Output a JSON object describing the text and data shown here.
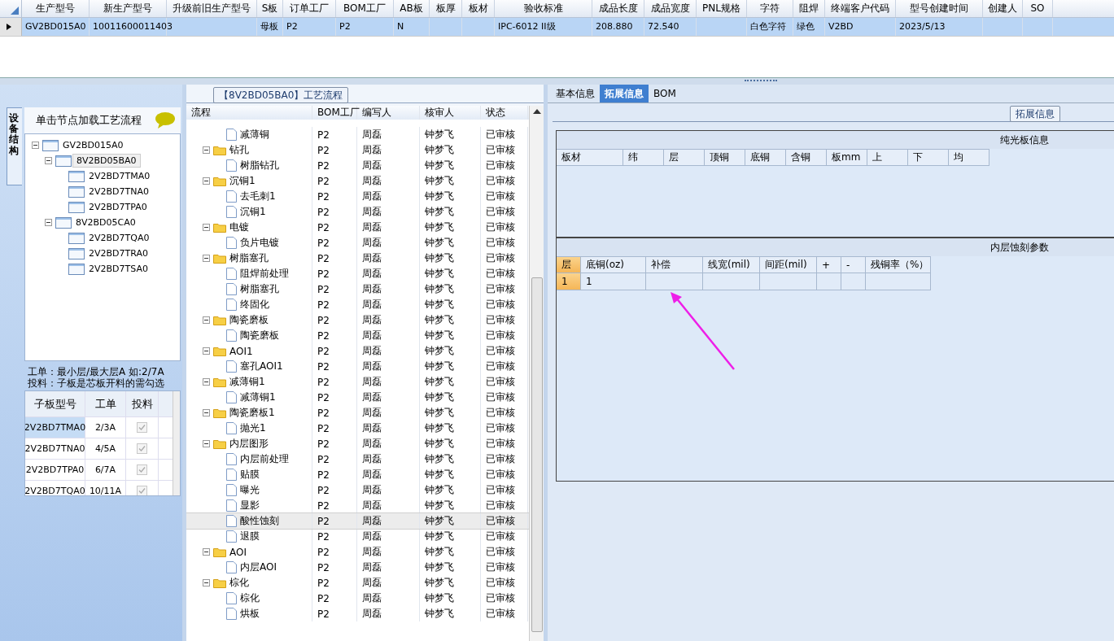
{
  "product_grid": {
    "columns": [
      {
        "label": "生产型号",
        "value": "GV2BD015A0"
      },
      {
        "label": "新生产型号",
        "value": "10011600011403"
      },
      {
        "label": "升级前旧生产型号"
      },
      {
        "label": "S板",
        "value": "母板"
      },
      {
        "label": "订单工厂",
        "value": "P2"
      },
      {
        "label": "BOM工厂",
        "value": "P2"
      },
      {
        "label": "AB板",
        "value": "N"
      },
      {
        "label": "板厚"
      },
      {
        "label": "板材"
      },
      {
        "label": "验收标准",
        "value": "IPC-6012 II级"
      },
      {
        "label": "成品长度",
        "value": "208.880"
      },
      {
        "label": "成品宽度",
        "value": "72.540"
      },
      {
        "label": "PNL规格"
      },
      {
        "label": "字符",
        "value": "白色字符"
      },
      {
        "label": "阻焊",
        "value": "绿色"
      },
      {
        "label": "终端客户代码",
        "value": "V2BD"
      },
      {
        "label": "型号创建时间",
        "value": "2023/5/13"
      },
      {
        "label": "创建人"
      },
      {
        "label": "SO"
      }
    ],
    "row_selected": true
  },
  "structure_panel": {
    "side_tab": "设备结构",
    "hint": "单击节点加载工艺流程",
    "tree": [
      {
        "label": "GV2BD015A0",
        "expanded": true,
        "selected": false,
        "children": [
          {
            "label": "8V2BD05BA0",
            "expanded": true,
            "selected": true,
            "children": [
              {
                "label": "2V2BD7TMA0",
                "selected": false
              },
              {
                "label": "2V2BD7TNA0",
                "selected": false
              },
              {
                "label": "2V2BD7TPA0",
                "selected": false
              }
            ]
          },
          {
            "label": "8V2BD05CA0",
            "expanded": true,
            "selected": false,
            "children": [
              {
                "label": "2V2BD7TQA0",
                "selected": false
              },
              {
                "label": "2V2BD7TRA0",
                "selected": false
              },
              {
                "label": "2V2BD7TSA0",
                "selected": false
              }
            ]
          }
        ]
      }
    ],
    "notes": [
      "工单：最小层/最大层A 如:2/7A",
      "投料：子板是芯板开料的需勾选"
    ],
    "board_table": {
      "columns": [
        "子板型号",
        "工单",
        "投料"
      ],
      "rows": [
        {
          "model": "2V2BD7TMA0",
          "order": "2/3A",
          "feed": true,
          "selected": true
        },
        {
          "model": "2V2BD7TNA0",
          "order": "4/5A",
          "feed": true,
          "selected": false
        },
        {
          "model": "2V2BD7TPA0",
          "order": "6/7A",
          "feed": true,
          "selected": false
        },
        {
          "model": "2V2BD7TQA0",
          "order": "10/11A",
          "feed": true,
          "selected": false
        }
      ]
    }
  },
  "process": {
    "title": "【8V2BD05BA0】工艺流程",
    "columns": [
      "流程",
      "BOM工厂",
      "编写人",
      "核审人",
      "状态"
    ],
    "rows": [
      {
        "children": [
          {
            "name": "减薄铜",
            "factory": "P2",
            "author": "周磊",
            "reviewer": "钟梦飞",
            "status": "已审核",
            "selected": false
          }
        ]
      },
      {
        "name": "钻孔",
        "factory": "P2",
        "author": "周磊",
        "reviewer": "钟梦飞",
        "status": "已审核",
        "selected": false,
        "expanded": true,
        "children": [
          {
            "name": "树脂钻孔",
            "factory": "P2",
            "author": "周磊",
            "reviewer": "钟梦飞",
            "status": "已审核",
            "selected": false
          }
        ]
      },
      {
        "name": "沉铜1",
        "factory": "P2",
        "author": "周磊",
        "reviewer": "钟梦飞",
        "status": "已审核",
        "selected": false,
        "expanded": true,
        "children": [
          {
            "name": "去毛刺1",
            "factory": "P2",
            "author": "周磊",
            "reviewer": "钟梦飞",
            "status": "已审核",
            "selected": false
          },
          {
            "name": "沉铜1",
            "factory": "P2",
            "author": "周磊",
            "reviewer": "钟梦飞",
            "status": "已审核",
            "selected": false
          }
        ]
      },
      {
        "name": "电镀",
        "factory": "P2",
        "author": "周磊",
        "reviewer": "钟梦飞",
        "status": "已审核",
        "selected": false,
        "expanded": true,
        "children": [
          {
            "name": "负片电镀",
            "factory": "P2",
            "author": "周磊",
            "reviewer": "钟梦飞",
            "status": "已审核",
            "selected": false
          }
        ]
      },
      {
        "name": "树脂塞孔",
        "factory": "P2",
        "author": "周磊",
        "reviewer": "钟梦飞",
        "status": "已审核",
        "selected": false,
        "expanded": true,
        "children": [
          {
            "name": "阻焊前处理",
            "factory": "P2",
            "author": "周磊",
            "reviewer": "钟梦飞",
            "status": "已审核",
            "selected": false
          },
          {
            "name": "树脂塞孔",
            "factory": "P2",
            "author": "周磊",
            "reviewer": "钟梦飞",
            "status": "已审核",
            "selected": false
          },
          {
            "name": "终固化",
            "factory": "P2",
            "author": "周磊",
            "reviewer": "钟梦飞",
            "status": "已审核",
            "selected": false
          }
        ]
      },
      {
        "name": "陶瓷磨板",
        "factory": "P2",
        "author": "周磊",
        "reviewer": "钟梦飞",
        "status": "已审核",
        "selected": false,
        "expanded": true,
        "children": [
          {
            "name": "陶瓷磨板",
            "factory": "P2",
            "author": "周磊",
            "reviewer": "钟梦飞",
            "status": "已审核",
            "selected": false
          }
        ]
      },
      {
        "name": "AOI1",
        "factory": "P2",
        "author": "周磊",
        "reviewer": "钟梦飞",
        "status": "已审核",
        "selected": false,
        "expanded": true,
        "children": [
          {
            "name": "塞孔AOI1",
            "factory": "P2",
            "author": "周磊",
            "reviewer": "钟梦飞",
            "status": "已审核",
            "selected": false
          }
        ]
      },
      {
        "name": "减薄铜1",
        "factory": "P2",
        "author": "周磊",
        "reviewer": "钟梦飞",
        "status": "已审核",
        "selected": false,
        "expanded": true,
        "children": [
          {
            "name": "减薄铜1",
            "factory": "P2",
            "author": "周磊",
            "reviewer": "钟梦飞",
            "status": "已审核",
            "selected": false
          }
        ]
      },
      {
        "name": "陶瓷磨板1",
        "factory": "P2",
        "author": "周磊",
        "reviewer": "钟梦飞",
        "status": "已审核",
        "selected": false,
        "expanded": true,
        "children": [
          {
            "name": "抛光1",
            "factory": "P2",
            "author": "周磊",
            "reviewer": "钟梦飞",
            "status": "已审核",
            "selected": false
          }
        ]
      },
      {
        "name": "内层图形",
        "factory": "P2",
        "author": "周磊",
        "reviewer": "钟梦飞",
        "status": "已审核",
        "selected": false,
        "expanded": true,
        "children": [
          {
            "name": "内层前处理",
            "factory": "P2",
            "author": "周磊",
            "reviewer": "钟梦飞",
            "status": "已审核",
            "selected": false
          },
          {
            "name": "贴膜",
            "factory": "P2",
            "author": "周磊",
            "reviewer": "钟梦飞",
            "status": "已审核",
            "selected": false
          },
          {
            "name": "曝光",
            "factory": "P2",
            "author": "周磊",
            "reviewer": "钟梦飞",
            "status": "已审核",
            "selected": false
          },
          {
            "name": "显影",
            "factory": "P2",
            "author": "周磊",
            "reviewer": "钟梦飞",
            "status": "已审核",
            "selected": false
          },
          {
            "name": "酸性蚀刻",
            "factory": "P2",
            "author": "周磊",
            "reviewer": "钟梦飞",
            "status": "已审核",
            "selected": true
          },
          {
            "name": "退膜",
            "factory": "P2",
            "author": "周磊",
            "reviewer": "钟梦飞",
            "status": "已审核",
            "selected": false
          }
        ]
      },
      {
        "name": "AOI",
        "factory": "P2",
        "author": "周磊",
        "reviewer": "钟梦飞",
        "status": "已审核",
        "selected": false,
        "expanded": true,
        "children": [
          {
            "name": "内层AOI",
            "factory": "P2",
            "author": "周磊",
            "reviewer": "钟梦飞",
            "status": "已审核",
            "selected": false
          }
        ]
      },
      {
        "name": "棕化",
        "factory": "P2",
        "author": "周磊",
        "reviewer": "钟梦飞",
        "status": "已审核",
        "selected": false,
        "expanded": true,
        "children": [
          {
            "name": "棕化",
            "factory": "P2",
            "author": "周磊",
            "reviewer": "钟梦飞",
            "status": "已审核",
            "selected": false
          },
          {
            "name": "烘板",
            "factory": "P2",
            "author": "周磊",
            "reviewer": "钟梦飞",
            "status": "已审核",
            "selected": false
          }
        ]
      }
    ]
  },
  "detail": {
    "tabs": [
      {
        "label": "基本信息",
        "selected": false
      },
      {
        "label": "拓展信息",
        "selected": true
      },
      {
        "label": "BOM",
        "selected": false
      }
    ],
    "group_title": "拓展信息",
    "plain_board": {
      "title": "纯光板信息",
      "columns": [
        "板材",
        "纬",
        "层",
        "顶铜",
        "底铜",
        "含铜",
        "板mm",
        "上",
        "下",
        "均"
      ]
    },
    "etch_params": {
      "title": "内层蚀刻参数",
      "columns": [
        "层",
        "底铜(oz)",
        "补偿",
        "线宽(mil)",
        "间距(mil)",
        "+",
        "-",
        "残铜率（%）"
      ],
      "rows": [
        {
          "cells": [
            "1",
            "1"
          ],
          "selected": true
        }
      ]
    }
  }
}
